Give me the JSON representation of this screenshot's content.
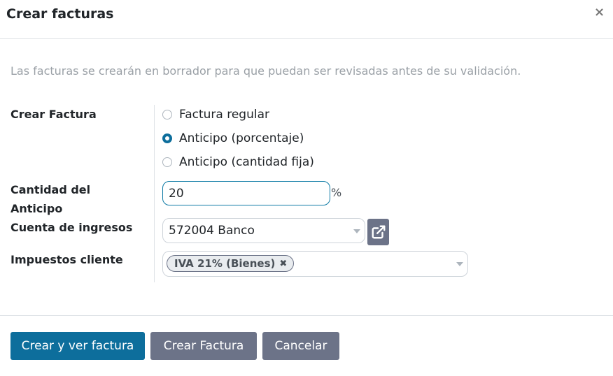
{
  "dialog": {
    "title": "Crear facturas",
    "close_symbol": "×",
    "info_text": "Las facturas se crearán en borrador para que puedan ser revisadas antes de su validación."
  },
  "form": {
    "create_invoice": {
      "label": "Crear Factura",
      "options": [
        {
          "label": "Factura regular",
          "checked": false
        },
        {
          "label": "Anticipo (porcentaje)",
          "checked": true
        },
        {
          "label": "Anticipo (cantidad fija)",
          "checked": false
        }
      ]
    },
    "advance_amount": {
      "label_line1": "Cantidad del",
      "label_line2": "Anticipo",
      "value": "20",
      "unit": "%"
    },
    "income_account": {
      "label": "Cuenta de ingresos",
      "value": "572004 Banco"
    },
    "customer_taxes": {
      "label": "Impuestos cliente",
      "tags": [
        "IVA 21% (Bienes)"
      ],
      "remove_symbol": "✖"
    }
  },
  "footer": {
    "create_and_view_label": "Crear y ver factura",
    "create_label": "Crear Factura",
    "cancel_label": "Cancelar"
  },
  "colors": {
    "primary": "#0d6e9c",
    "secondary": "#6c7388",
    "focus_border": "#0d7aa5"
  },
  "icons": {
    "external_link": "external-link-icon",
    "close": "close-icon",
    "dropdown": "caret-down-icon"
  }
}
